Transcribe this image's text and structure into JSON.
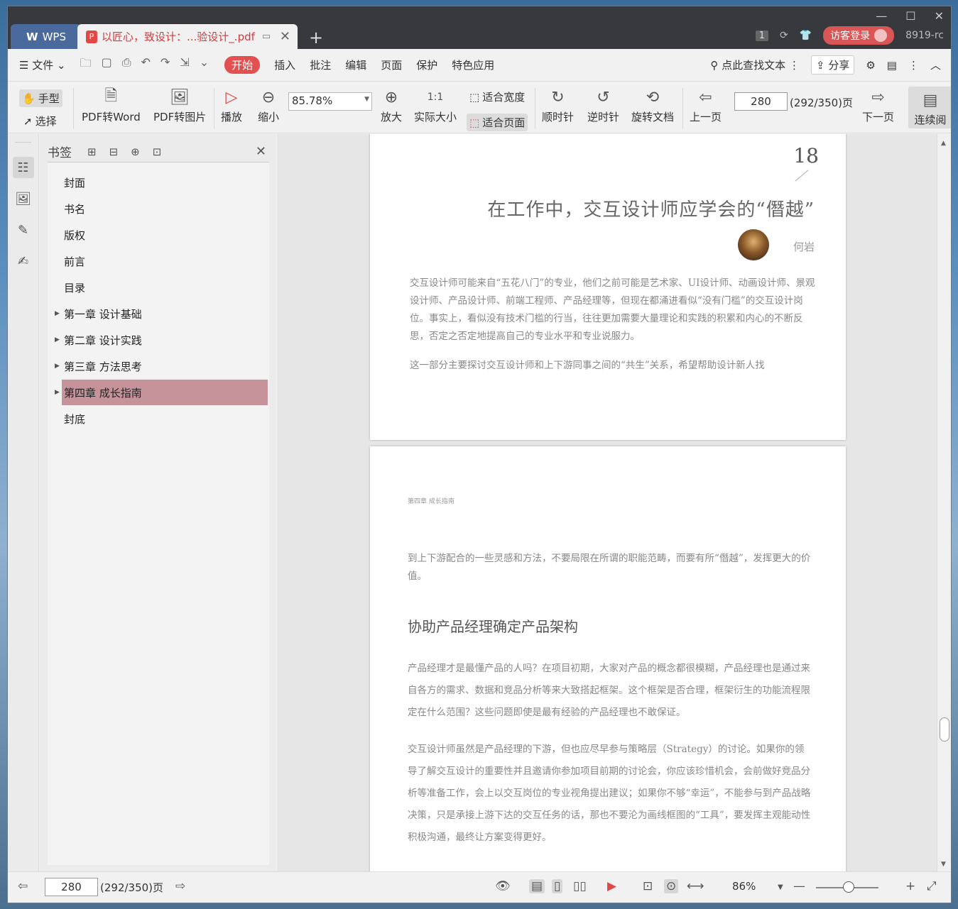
{
  "titlebar": {
    "app_tab": "WPS",
    "doc_tab": "以匠心，致设计：...验设计_.pdf",
    "page_count_badge": "1",
    "login_label": "访客登录",
    "user_suffix": "8919-rc"
  },
  "menubar": {
    "file": "文件",
    "tabs": [
      "开始",
      "插入",
      "批注",
      "编辑",
      "页面",
      "保护",
      "特色应用"
    ],
    "search": "点此查找文本",
    "share": "分享"
  },
  "toolbar": {
    "hand": "手型",
    "select": "选择",
    "pdf_to_word": "PDF转Word",
    "pdf_to_image": "PDF转图片",
    "play": "播放",
    "zoom_out": "缩小",
    "zoom_value": "85.78%",
    "zoom_in": "放大",
    "actual_size": "实际大小",
    "fit_width": "适合宽度",
    "fit_page": "适合页面",
    "clockwise": "顺时针",
    "counterclockwise": "逆时针",
    "rotate_doc": "旋转文档",
    "prev_page": "上一页",
    "page_input": "280",
    "page_total": "(292/350)页",
    "next_page": "下一页",
    "continuous": "连续阅"
  },
  "bookmarks": {
    "title": "书签",
    "items": [
      {
        "label": "封面",
        "expandable": false
      },
      {
        "label": "书名",
        "expandable": false
      },
      {
        "label": "版权",
        "expandable": false
      },
      {
        "label": "前言",
        "expandable": false
      },
      {
        "label": "目录",
        "expandable": false
      },
      {
        "label": "第一章  设计基础",
        "expandable": true
      },
      {
        "label": "第二章  设计实践",
        "expandable": true
      },
      {
        "label": "第三章  方法思考",
        "expandable": true
      },
      {
        "label": "第四章  成长指南",
        "expandable": true,
        "selected": true
      },
      {
        "label": "封底",
        "expandable": false
      }
    ]
  },
  "page1": {
    "number": "18",
    "title": "在工作中，交互设计师应学会的“僭越”",
    "author": "何岩",
    "para1": "交互设计师可能来自“五花八门”的专业，他们之前可能是艺术家、UI设计师、动画设计师、景观设计师、产品设计师、前端工程师、产品经理等，但现在都涌进看似“没有门槛”的交互设计岗位。事实上，看似没有技术门槛的行当，往往更加需要大量理论和实践的积累和内心的不断反思，否定之否定地提高自己的专业水平和专业说服力。",
    "para2": "这一部分主要探讨交互设计师和上下游同事之间的“共生”关系，希望帮助设计新人找"
  },
  "page2": {
    "running_head": "第四章  成长指南",
    "para0": "到上下游配合的一些灵感和方法，不要局限在所谓的职能范畴，而要有所“僭越”，发挥更大的价值。",
    "heading": "协助产品经理确定产品架构",
    "para1": "产品经理才是最懂产品的人吗？在项目初期，大家对产品的概念都很模糊，产品经理也是通过来自各方的需求、数据和竞品分析等来大致搭起框架。这个框架是否合理，框架衍生的功能流程限定在什么范围？这些问题即使是最有经验的产品经理也不敢保证。",
    "para2": "交互设计师虽然是产品经理的下游，但也应尽早参与策略层（Strategy）的讨论。如果你的领导了解交互设计的重要性并且邀请你参加项目前期的讨论会，你应该珍惜机会，会前做好竞品分析等准备工作，会上以交互岗位的专业视角提出建议；如果你不够“幸运”，不能参与到产品战略决策，只是承接上游下达的交互任务的话，那也不要沦为画线框图的“工具”，要发挥主观能动性积极沟通，最终让方案变得更好。"
  },
  "statusbar": {
    "page_input": "280",
    "page_total": "(292/350)页",
    "zoom": "86%"
  },
  "colors": {
    "accent": "#e25050",
    "selected_bookmark": "#c6939b",
    "title_bar": "#38393d"
  }
}
